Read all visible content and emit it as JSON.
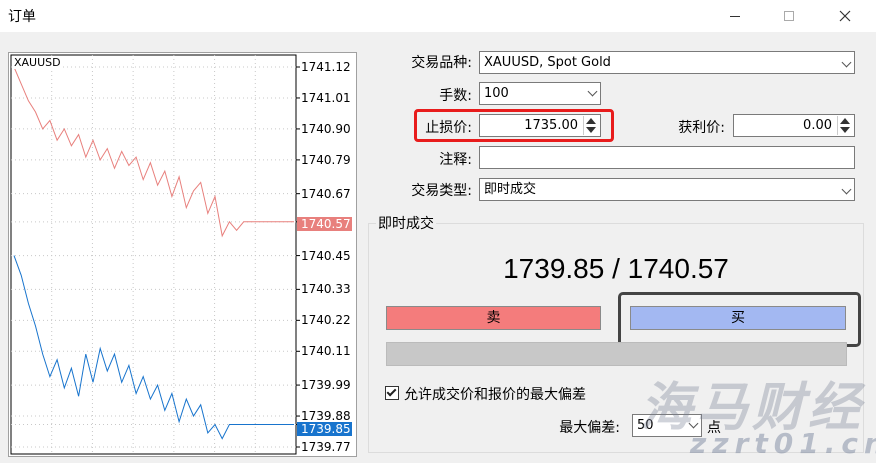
{
  "window": {
    "title": "订单"
  },
  "chart": {
    "symbol": "XAUUSD",
    "price_ticks": [
      "1741.12",
      "1741.01",
      "1740.90",
      "1740.79",
      "1740.67",
      "1740.57",
      "1740.45",
      "1740.33",
      "1740.22",
      "1740.11",
      "1739.99",
      "1739.88",
      "1739.85",
      "1739.77"
    ],
    "ask_tag": "1740.57",
    "bid_tag": "1739.85",
    "ask_color": "#e8807d",
    "bid_color": "#1874cd"
  },
  "chart_data": {
    "type": "line",
    "title": "XAUUSD",
    "ylim": [
      1739.77,
      1741.12
    ],
    "grid": true,
    "series": [
      {
        "name": "",
        "color": "#e8807d",
        "values": [
          1741.12,
          1741.06,
          1741.0,
          1740.96,
          1740.9,
          1740.93,
          1740.86,
          1740.9,
          1740.84,
          1740.88,
          1740.8,
          1740.86,
          1740.79,
          1740.83,
          1740.76,
          1740.82,
          1740.77,
          1740.8,
          1740.72,
          1740.78,
          1740.7,
          1740.75,
          1740.66,
          1740.73,
          1740.62,
          1740.68,
          1740.71,
          1740.6,
          1740.66,
          1740.52,
          1740.57,
          1740.54,
          1740.57,
          1740.57,
          1740.57,
          1740.57,
          1740.57,
          1740.57,
          1740.57,
          1740.57
        ]
      },
      {
        "name": "",
        "color": "#1874cd",
        "values": [
          1740.45,
          1740.38,
          1740.28,
          1740.2,
          1740.1,
          1740.02,
          1740.08,
          1739.98,
          1740.05,
          1739.95,
          1740.1,
          1740.0,
          1740.12,
          1740.04,
          1740.1,
          1740.0,
          1740.06,
          1739.96,
          1740.02,
          1739.94,
          1739.99,
          1739.9,
          1739.96,
          1739.86,
          1739.94,
          1739.88,
          1739.92,
          1739.82,
          1739.85,
          1739.8,
          1739.85,
          1739.85,
          1739.85,
          1739.85,
          1739.85,
          1739.85,
          1739.85,
          1739.85,
          1739.85,
          1739.85
        ]
      }
    ]
  },
  "form": {
    "symbol_label": "交易品种:",
    "symbol_value": "XAUUSD, Spot Gold",
    "volume_label": "手数:",
    "volume_value": "100",
    "stoploss_label": "止损价:",
    "stoploss_value": "1735.00",
    "takeprofit_label": "获利价:",
    "takeprofit_value": "0.00",
    "comment_label": "注释:",
    "comment_value": "",
    "type_label": "交易类型:",
    "type_value": "即时成交"
  },
  "execution": {
    "group_title": "即时成交",
    "quote": "1739.85 / 1740.57",
    "sell_label": "卖",
    "buy_label": "买",
    "sell_color": "#f47c7c",
    "buy_color": "#a3b8f2",
    "allow_deviation_label": "允许成交价和报价的最大偏差",
    "allow_deviation_checked": true,
    "max_deviation_label": "最大偏差:",
    "max_deviation_value": "50",
    "points_label": "点"
  },
  "watermark": {
    "line1": "海马财经",
    "line2": "zzrt01.cn"
  }
}
